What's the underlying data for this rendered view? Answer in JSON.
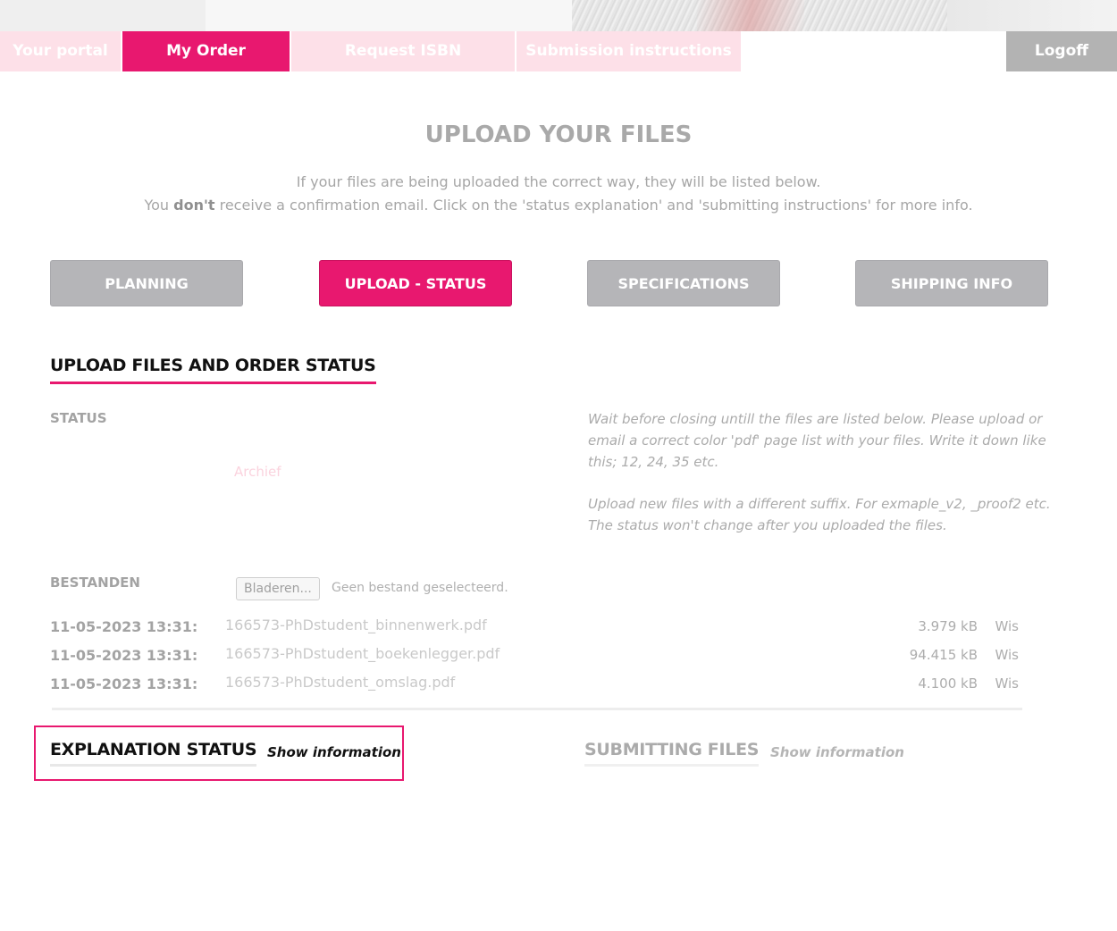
{
  "nav": {
    "tabs": [
      {
        "label": "Your portal"
      },
      {
        "label": "My Order"
      },
      {
        "label": "Request ISBN"
      },
      {
        "label": "Submission instructions"
      }
    ],
    "logoff": "Logoff"
  },
  "page": {
    "title": "UPLOAD YOUR FILES",
    "intro_line1": "If your files are being uploaded the correct way, they will be listed below.",
    "intro_line2_pre": "You ",
    "intro_line2_bold": "don't",
    "intro_line2_post": " receive a confirmation email. Click on the 'status explanation' and 'submitting instructions' for more info."
  },
  "sections": [
    {
      "label": "PLANNING"
    },
    {
      "label": "UPLOAD - STATUS"
    },
    {
      "label": "SPECIFICATIONS"
    },
    {
      "label": "SHIPPING INFO"
    }
  ],
  "upload": {
    "heading": "UPLOAD FILES AND ORDER STATUS",
    "status_label": "STATUS",
    "archief_link": "Archief",
    "info_para1": "Wait before closing untill the files are listed below. Please upload or email a correct color 'pdf' page list with your files. Write it down like this; 12, 24, 35 etc.",
    "info_para2": "Upload new files with a different suffix. For exmaple_v2, _proof2 etc. The status won't change after you uploaded the files.",
    "files_label": "BESTANDEN",
    "browse_button": "Bladeren...",
    "no_file_text": "Geen bestand geselecteerd.",
    "files": [
      {
        "date": "11-05-2023 13:31:",
        "name": "166573-PhDstudent_binnenwerk.pdf",
        "size": "3.979 kB",
        "delete": "Wis"
      },
      {
        "date": "11-05-2023 13:31:",
        "name": "166573-PhDstudent_boekenlegger.pdf",
        "size": "94.415 kB",
        "delete": "Wis"
      },
      {
        "date": "11-05-2023 13:31:",
        "name": "166573-PhDstudent_omslag.pdf",
        "size": "4.100 kB",
        "delete": "Wis"
      }
    ]
  },
  "explanation": {
    "title": "EXPLANATION STATUS",
    "show": "Show information"
  },
  "submitting": {
    "title": "SUBMITTING FILES",
    "show": "Show information"
  },
  "colors": {
    "accent": "#e8186f",
    "tab_inactive": "#fde0e8",
    "button_gray": "#b5b5b8"
  }
}
